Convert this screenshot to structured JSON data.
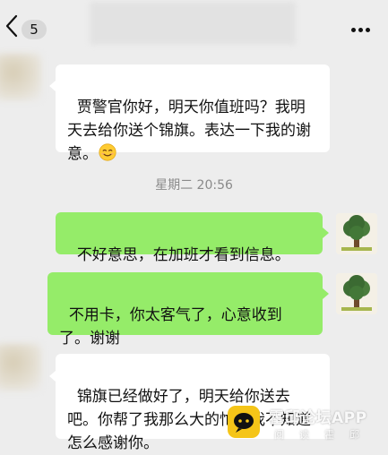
{
  "header": {
    "unread_count": "5",
    "back_icon": "chevron-left-icon",
    "more_icon": "more-dots-icon"
  },
  "messages": [
    {
      "side": "left",
      "text": "贾警官你好，明天你值班吗？我明天去给你送个锦旗。表达一下我的谢意。",
      "emoji": "smile-emoji-icon"
    },
    {
      "side": "right",
      "text": "不好意思，在加班才看到信息。"
    },
    {
      "side": "right",
      "text": "不用卡，你太客气了，心意收到了。谢谢"
    },
    {
      "side": "left",
      "text": "锦旗已经做好了，明天给你送去吧。你帮了我那么大的忙，我不知道怎么感谢你。"
    }
  ],
  "timestamp": "星期二 20:56",
  "watermark": {
    "title": "霍邱论坛APP",
    "subtitle": "阅读霍邱"
  },
  "colors": {
    "background": "#ededed",
    "outgoing_bubble": "#95ec69",
    "incoming_bubble": "#ffffff",
    "timestamp": "#8a8a8a"
  }
}
